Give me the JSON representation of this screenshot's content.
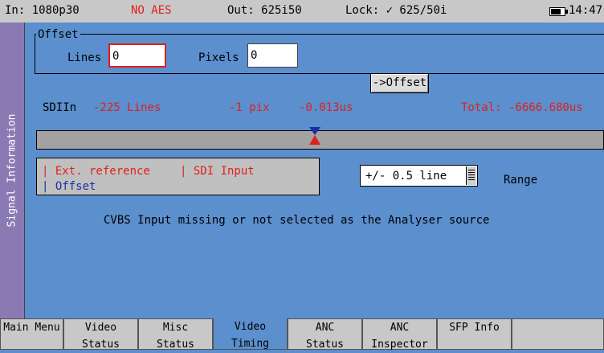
{
  "status": {
    "input": "In: 1080p30",
    "aes": "NO AES",
    "output": "Out: 625i50",
    "lock": "Lock: ✓ 625/50i",
    "time": "14:47",
    "aes_color": "#e0201c"
  },
  "side_tab": {
    "label": "Signal Information"
  },
  "offset": {
    "legend": "Offset",
    "lines_label": "Lines",
    "lines_value": "0",
    "pixels_label": "Pixels",
    "pixels_value": "0"
  },
  "timing": {
    "source_label": "SDIIn",
    "lines": "-225 Lines",
    "pix": "-1 pix",
    "us": "-0.013us",
    "offset_button": "->Offset",
    "total": "Total: -6666.680us"
  },
  "legend": {
    "ext_reference": "| Ext. reference",
    "sdi_input": "| SDI Input",
    "offset": "| Offset",
    "ext_color": "#e0201c",
    "sdi_color": "#e0201c",
    "offset_color": "#1a2ea8"
  },
  "range": {
    "value": "+/- 0.5 line",
    "label": "Range"
  },
  "message": "CVBS Input missing or not selected as the Analyser source",
  "tabs": [
    {
      "line1": "Main Menu",
      "line2": ""
    },
    {
      "line1": "Video",
      "line2": "Status"
    },
    {
      "line1": "Misc",
      "line2": "Status"
    },
    {
      "line1": "Video",
      "line2": "Timing"
    },
    {
      "line1": "ANC",
      "line2": "Status"
    },
    {
      "line1": "ANC",
      "line2": "Inspector"
    },
    {
      "line1": "SFP Info",
      "line2": ""
    }
  ]
}
